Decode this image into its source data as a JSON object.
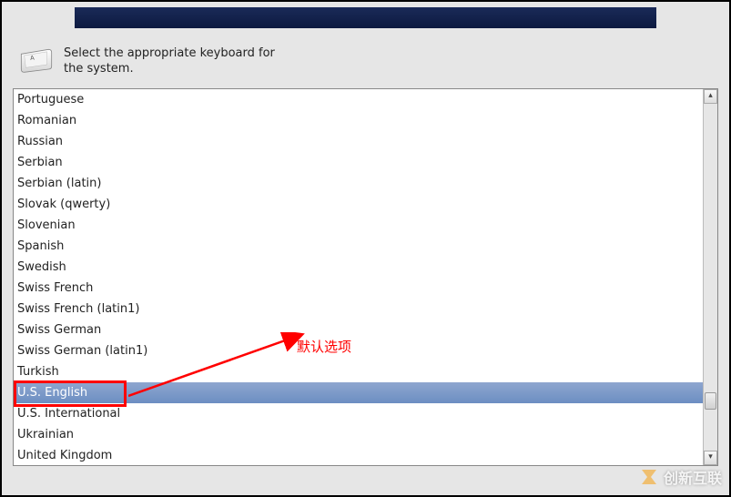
{
  "instruction": {
    "line1": "Select the appropriate keyboard for",
    "line2": "the system."
  },
  "keyboard_list": [
    "Portuguese",
    "Romanian",
    "Russian",
    "Serbian",
    "Serbian (latin)",
    "Slovak (qwerty)",
    "Slovenian",
    "Spanish",
    "Swedish",
    "Swiss French",
    "Swiss French (latin1)",
    "Swiss German",
    "Swiss German (latin1)",
    "Turkish",
    "U.S. English",
    "U.S. International",
    "Ukrainian",
    "United Kingdom"
  ],
  "selected_index": 14,
  "annotation_text": "默认选项",
  "watermark_text": "创新互联"
}
